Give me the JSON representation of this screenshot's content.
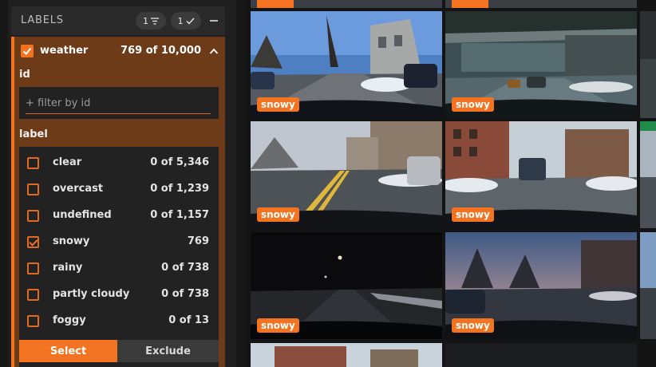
{
  "sidebar": {
    "title": "LABELS",
    "filter_pill_count": "1",
    "check_pill_count": "1"
  },
  "field": {
    "name": "weather",
    "count": "769 of 10,000",
    "id_section": "id",
    "id_placeholder": "+ filter by id",
    "label_section": "label",
    "values": [
      {
        "label": "clear",
        "count": "0 of 5,346",
        "checked": false
      },
      {
        "label": "overcast",
        "count": "0 of 1,239",
        "checked": false
      },
      {
        "label": "undefined",
        "count": "0 of 1,157",
        "checked": false
      },
      {
        "label": "snowy",
        "count": "769",
        "checked": true
      },
      {
        "label": "rainy",
        "count": "0 of 738",
        "checked": false
      },
      {
        "label": "partly cloudy",
        "count": "0 of 738",
        "checked": false
      },
      {
        "label": "foggy",
        "count": "0 of 13",
        "checked": false
      }
    ],
    "select_label": "Select",
    "exclude_label": "Exclude"
  },
  "grid": {
    "tiles": [
      {
        "tag": "snowy"
      },
      {
        "tag": "snowy"
      },
      {
        "tag": "snowy"
      },
      {
        "tag": "snowy"
      },
      {
        "tag": "snowy"
      },
      {
        "tag": "snowy"
      }
    ]
  },
  "colors": {
    "accent": "#f37321",
    "panel": "#6d3b17",
    "background": "#1b1b1b"
  }
}
